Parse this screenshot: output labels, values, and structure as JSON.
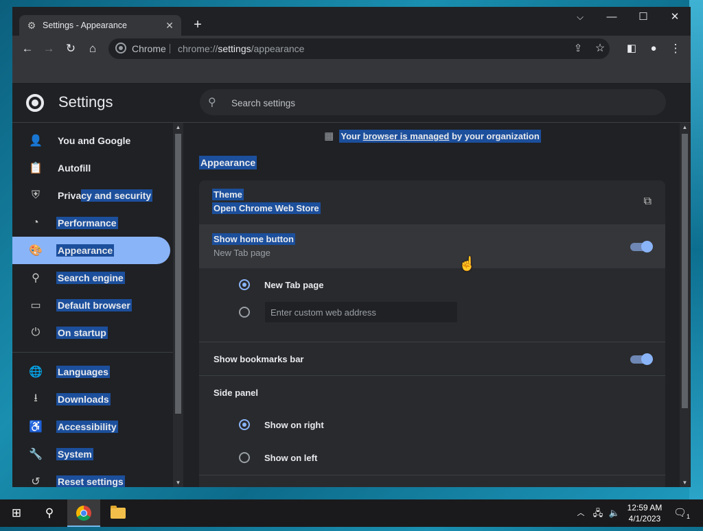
{
  "tab": {
    "title": "Settings - Appearance",
    "close": "✕",
    "new_tab": "+"
  },
  "window_controls": {
    "list": "⌵",
    "minimize": "—",
    "maximize": "☐",
    "close": "✕"
  },
  "omnibox": {
    "chip": "Chrome",
    "url_prefix": "chrome://",
    "url_host": "settings",
    "url_path": "/appearance"
  },
  "settings": {
    "title": "Settings",
    "search_placeholder": "Search settings"
  },
  "sidebar": {
    "items": [
      {
        "label": "You and Google",
        "icon": "person-icon"
      },
      {
        "label": "Autofill",
        "icon": "clipboard-icon"
      },
      {
        "label": "Privacy and security",
        "label_a": "Priva",
        "label_b": "cy and security",
        "icon": "shield-icon"
      },
      {
        "label": "Performance",
        "icon": "speedometer-icon"
      },
      {
        "label": "Appearance",
        "icon": "palette-icon"
      },
      {
        "label": "Search engine",
        "icon": "search-icon"
      },
      {
        "label": "Default browser",
        "icon": "browser-icon"
      },
      {
        "label": "On startup",
        "icon": "power-icon"
      },
      {
        "label": "Languages",
        "icon": "globe-icon"
      },
      {
        "label": "Downloads",
        "icon": "download-icon"
      },
      {
        "label": "Accessibility",
        "icon": "accessibility-icon"
      },
      {
        "label": "System",
        "icon": "wrench-icon"
      },
      {
        "label": "Reset settings",
        "icon": "restore-icon"
      }
    ]
  },
  "main": {
    "managed": {
      "prefix": "Your ",
      "link": "browser is managed",
      "suffix": " by your organization"
    },
    "section_title": "Appearance",
    "theme": {
      "title": "Theme",
      "subtitle": "Open Chrome Web Store"
    },
    "home_button": {
      "title": "Show home button",
      "subtitle": "New Tab page",
      "enabled": true,
      "options": [
        {
          "label": "New Tab page",
          "selected": true
        }
      ],
      "custom_placeholder": "Enter custom web address"
    },
    "bookmarks_bar": {
      "title": "Show bookmarks bar",
      "enabled": true
    },
    "side_panel": {
      "title": "Side panel",
      "options": [
        {
          "label": "Show on right",
          "selected": true
        },
        {
          "label": "Show on left",
          "selected": false
        }
      ]
    }
  },
  "taskbar": {
    "time": "12:59 AM",
    "date": "4/1/2023",
    "notifications": "1"
  },
  "colors": {
    "accent": "#8ab4f8",
    "selection": "#1c4f9c",
    "background": "#202124",
    "card": "#292a2d"
  }
}
